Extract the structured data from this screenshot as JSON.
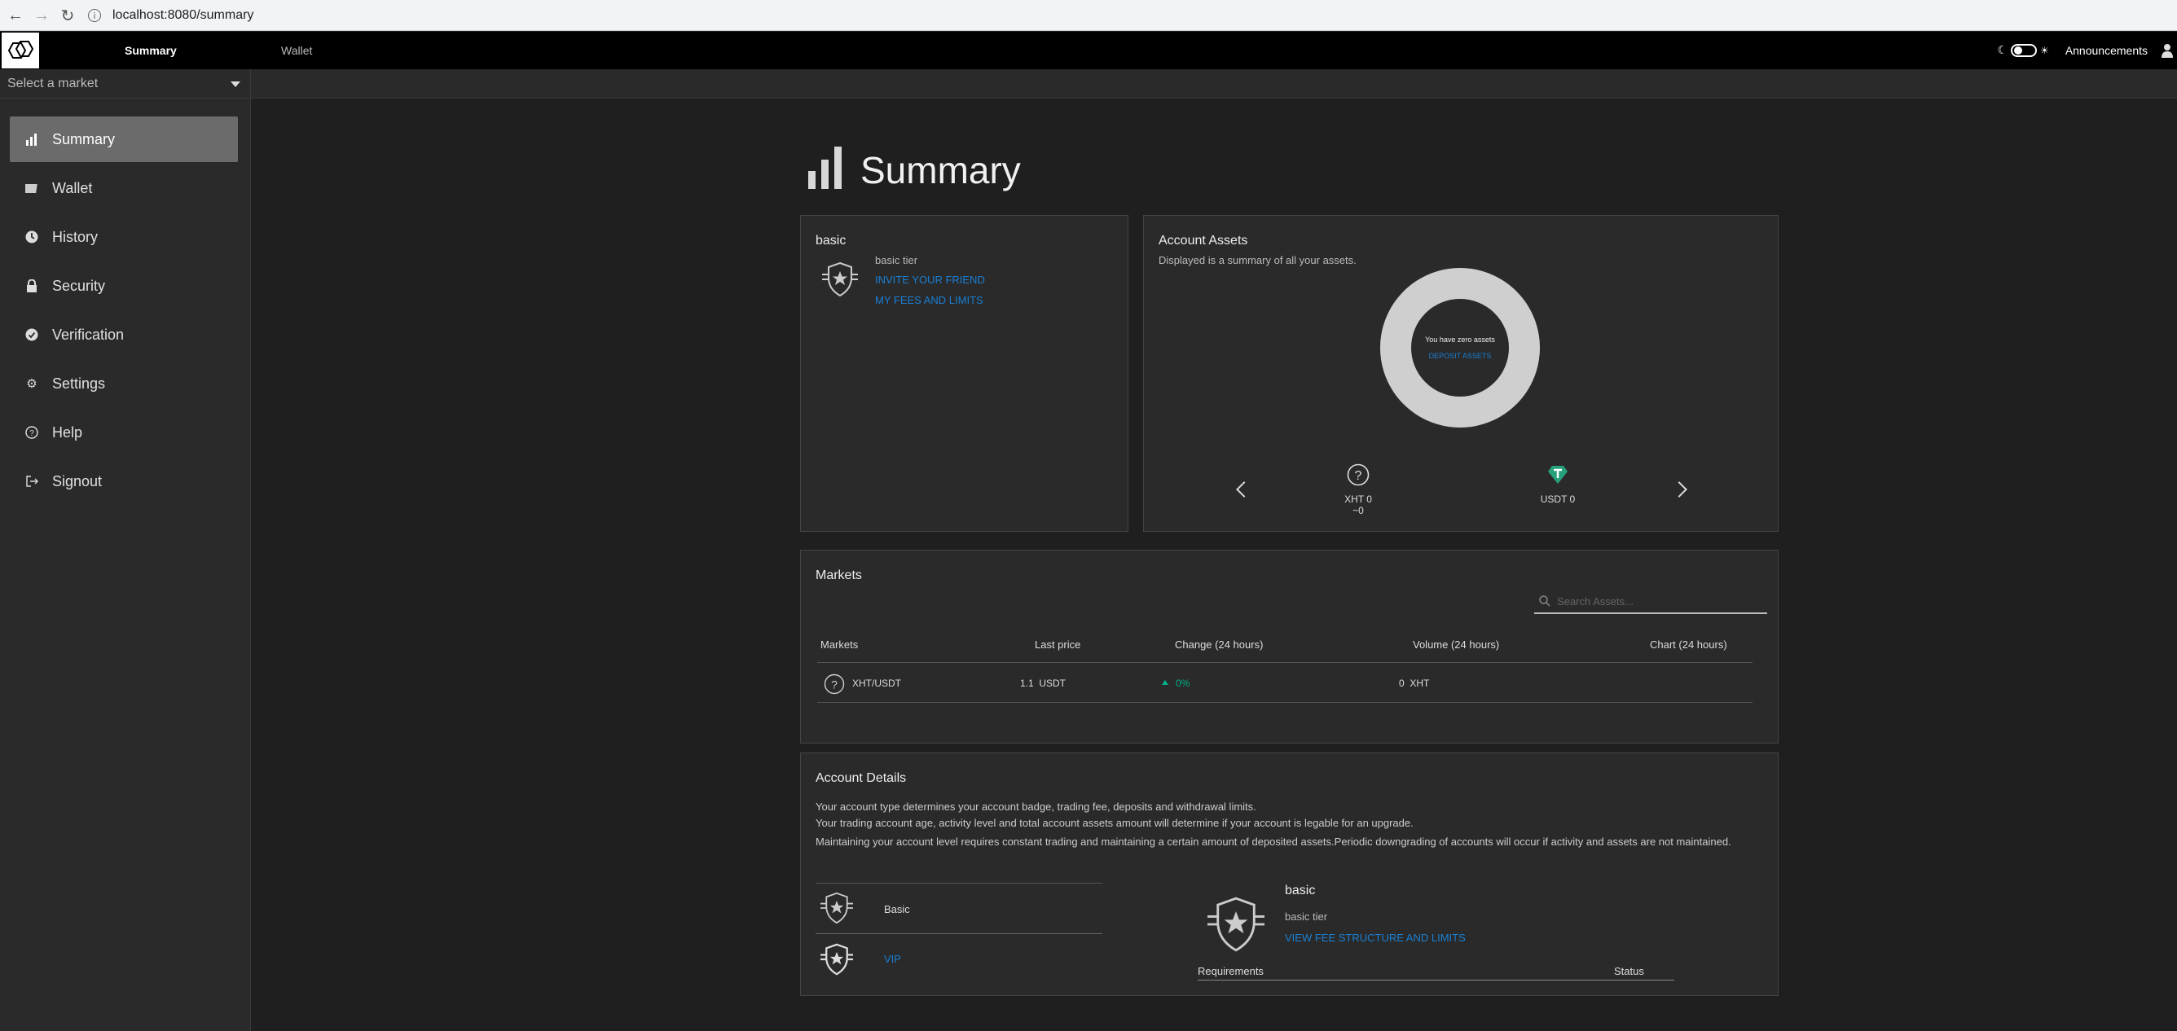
{
  "browser": {
    "url": "localhost:8080/summary"
  },
  "topbar": {
    "tabs": [
      "Summary",
      "Wallet"
    ],
    "announcements": "Announcements"
  },
  "market_select": {
    "placeholder": "Select a market"
  },
  "sidebar": {
    "items": [
      {
        "label": "Summary",
        "icon": "bar-chart-icon",
        "active": true
      },
      {
        "label": "Wallet",
        "icon": "wallet-icon"
      },
      {
        "label": "History",
        "icon": "clock-icon"
      },
      {
        "label": "Security",
        "icon": "lock-icon"
      },
      {
        "label": "Verification",
        "icon": "check-circle-icon"
      },
      {
        "label": "Settings",
        "icon": "gear-icon"
      },
      {
        "label": "Help",
        "icon": "question-circle-icon"
      },
      {
        "label": "Signout",
        "icon": "signout-icon"
      }
    ]
  },
  "page": {
    "title": "Summary"
  },
  "tier_card": {
    "title": "basic",
    "tier_label": "basic tier",
    "invite_link": "INVITE YOUR FRIEND",
    "fees_link": "MY FEES AND LIMITS"
  },
  "assets_card": {
    "title": "Account Assets",
    "subtitle": "Displayed is a summary of all your assets.",
    "donut_text": "You have zero assets",
    "deposit_link": "DEPOSIT ASSETS",
    "assets": [
      {
        "name": "XHT 0",
        "sub": "~0",
        "icon": "question-circle-icon"
      },
      {
        "name": "USDT 0",
        "sub": "",
        "icon": "tether-icon",
        "color": "#26a17b"
      }
    ]
  },
  "markets_card": {
    "title": "Markets",
    "search_placeholder": "Search Assets...",
    "columns": [
      "Markets",
      "Last price",
      "Change (24 hours)",
      "Volume (24 hours)",
      "Chart (24 hours)"
    ],
    "rows": [
      {
        "pair": "XHT/USDT",
        "price": "1.1  USDT",
        "change": "0%",
        "volume": "0  XHT"
      }
    ],
    "change_color": "#00b38a"
  },
  "account_details": {
    "title": "Account Details",
    "lines": [
      "Your account type determines your account badge, trading fee, deposits and withdrawal limits.",
      "Your trading account age, activity level and total account assets amount will determine if your account is legable for an upgrade.",
      "Maintaining your account level requires constant trading and maintaining a certain amount of deposited assets.Periodic downgrading of accounts will occur if activity and assets are not maintained."
    ],
    "levels": [
      "Basic",
      "VIP"
    ],
    "selected": {
      "title": "basic",
      "tier_label": "basic tier",
      "link": "VIEW FEE STRUCTURE AND LIMITS",
      "col_requirements": "Requirements",
      "col_status": "Status"
    }
  },
  "colors": {
    "link": "#1a7fd4",
    "bg": "#1f1f1f",
    "card": "#2a2a2a"
  }
}
